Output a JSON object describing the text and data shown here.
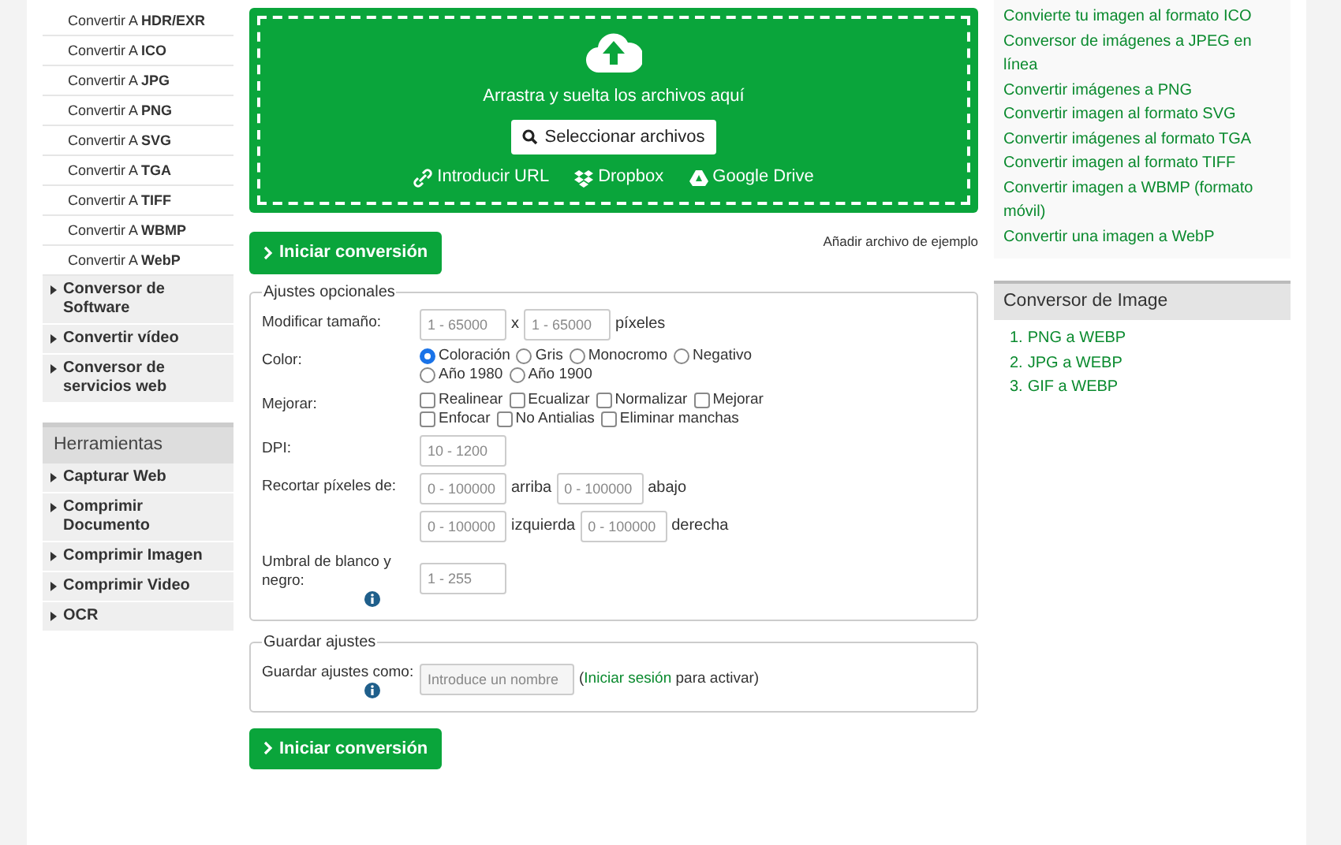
{
  "sidebar": {
    "format_items": [
      "Convertir A **HDR/EXR**",
      "Convertir A **ICO**",
      "Convertir A **JPG**",
      "Convertir A **PNG**",
      "Convertir A **SVG**",
      "Convertir A **TGA**",
      "Convertir A **TIFF**",
      "Convertir A **WBMP**",
      "Convertir A **WebP**"
    ],
    "categories": [
      "Conversor de Software",
      "Convertir vídeo",
      "Conversor de servicios web"
    ],
    "tools_title": "Herramientas",
    "tools": [
      "Capturar Web",
      "Comprimir Documento",
      "Comprimir Imagen",
      "Comprimir Video",
      "OCR"
    ]
  },
  "upload": {
    "drop_text": "Arrastra y suelta los archivos aquí",
    "select_button": "Seleccionar archivos",
    "sources": [
      {
        "kind": "url",
        "label": "Introducir URL"
      },
      {
        "kind": "dropbox",
        "label": "Dropbox"
      },
      {
        "kind": "drive",
        "label": "Google Drive"
      }
    ]
  },
  "sample_link": "Añadir archivo de ejemplo",
  "start_buttons": [
    "Iniciar conversión",
    "Iniciar conversión"
  ],
  "optional": {
    "legend": "Ajustes opcionales",
    "resize": {
      "label": "Modificar tamaño:",
      "width_placeholder": "1 - 65000",
      "separator": "x",
      "height_placeholder": "1 - 65000",
      "unit": "píxeles"
    },
    "color": {
      "label": "Color:",
      "options": [
        {
          "label": "Coloración",
          "selected": true
        },
        {
          "label": "Gris",
          "selected": false
        },
        {
          "label": "Monocromo",
          "selected": false
        },
        {
          "label": "Negativo",
          "selected": false
        },
        {
          "label": "Año 1980",
          "selected": false
        },
        {
          "label": "Año 1900",
          "selected": false
        }
      ]
    },
    "enhance": {
      "label": "Mejorar:",
      "options": [
        {
          "label": "Realinear",
          "checked": false
        },
        {
          "label": "Ecualizar",
          "checked": false
        },
        {
          "label": "Normalizar",
          "checked": false
        },
        {
          "label": "Mejorar",
          "checked": false
        },
        {
          "label": "Enfocar",
          "checked": false
        },
        {
          "label": "No Antialias",
          "checked": false
        },
        {
          "label": "Eliminar manchas",
          "checked": false
        }
      ]
    },
    "dpi": {
      "label": "DPI:",
      "placeholder": "10 - 1200"
    },
    "crop": {
      "label": "Recortar píxeles de:",
      "fields": [
        {
          "placeholder": "0 - 100000",
          "unit": "arriba"
        },
        {
          "placeholder": "0 - 100000",
          "unit": "abajo"
        },
        {
          "placeholder": "0 - 100000",
          "unit": "izquierda"
        },
        {
          "placeholder": "0 - 100000",
          "unit": "derecha"
        }
      ]
    },
    "threshold": {
      "label": "Umbral de blanco y negro:",
      "placeholder": "1 - 255"
    }
  },
  "save": {
    "legend": "Guardar ajustes",
    "label": "Guardar ajustes como:",
    "placeholder": "Introduce un nombre",
    "prefix": "(",
    "login_link": "Iniciar sesión",
    "suffix": "para activar)"
  },
  "related_links": [
    "Convierte tu imagen al formato ICO",
    "Conversor de imágenes a JPEG en línea",
    "Convertir imágenes a PNG",
    "Convertir imagen al formato SVG",
    "Convertir imágenes al formato TGA",
    "Convertir imagen al formato TIFF",
    "Convertir imagen a WBMP (formato móvil)",
    "Convertir una imagen a WebP"
  ],
  "image_converter": {
    "title": "Conversor de Image",
    "items": [
      {
        "number": "1.",
        "label": "PNG a WEBP"
      },
      {
        "number": "2.",
        "label": "JPG a WEBP"
      },
      {
        "number": "3.",
        "label": "GIF a WEBP"
      }
    ]
  }
}
